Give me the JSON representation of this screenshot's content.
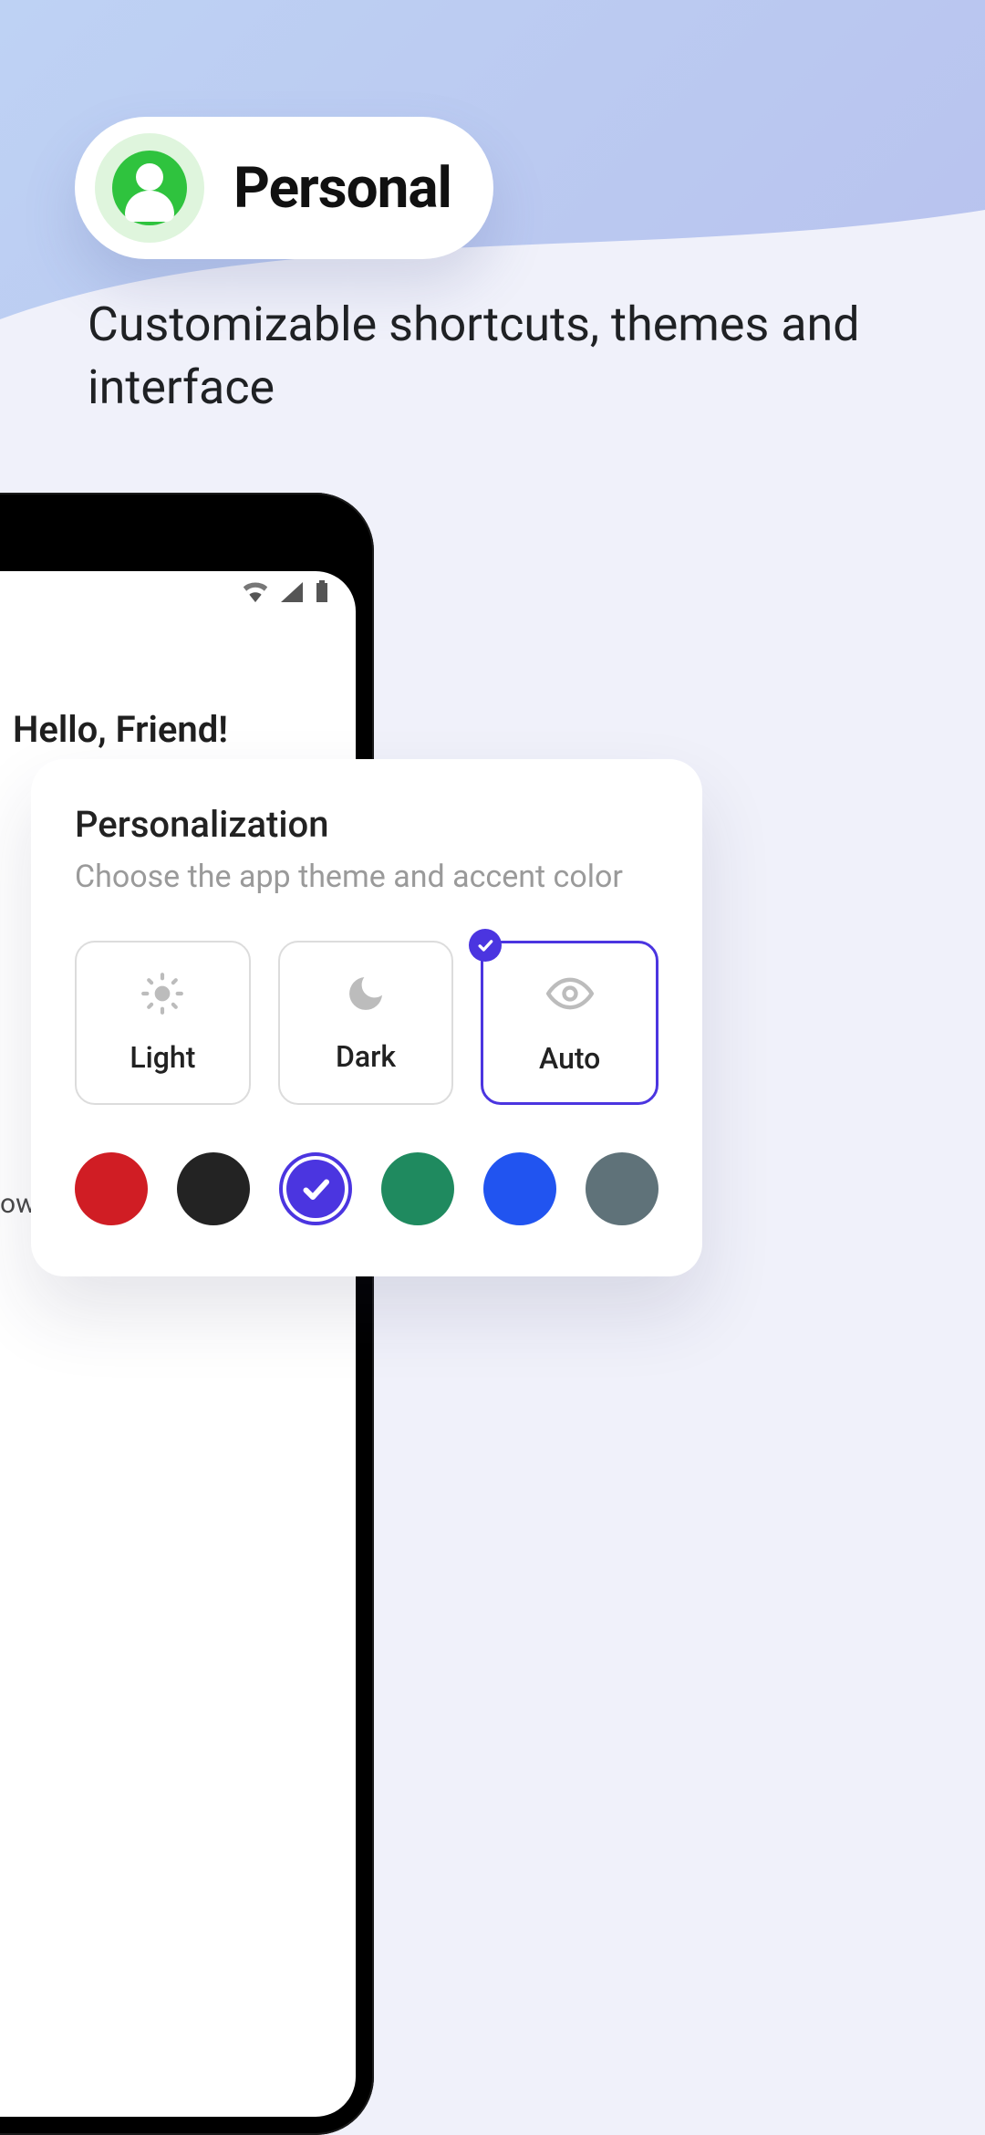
{
  "pill": {
    "title": "Personal"
  },
  "subhead": "Customizable shortcuts, themes and interface",
  "phone": {
    "greeting": "Hello, Friend!"
  },
  "card": {
    "title": "Personalization",
    "subtitle": "Choose the app theme and accent color",
    "themes": [
      {
        "label": "Light",
        "selected": false
      },
      {
        "label": "Dark",
        "selected": false
      },
      {
        "label": "Auto",
        "selected": true
      }
    ],
    "accents": [
      {
        "color": "#d01d24",
        "selected": false
      },
      {
        "color": "#232323",
        "selected": false
      },
      {
        "color": "#4b35e0",
        "selected": true
      },
      {
        "color": "#1f8a5f",
        "selected": false
      },
      {
        "color": "#2154f0",
        "selected": false
      },
      {
        "color": "#5f7279",
        "selected": false
      }
    ]
  },
  "clip": "ows"
}
